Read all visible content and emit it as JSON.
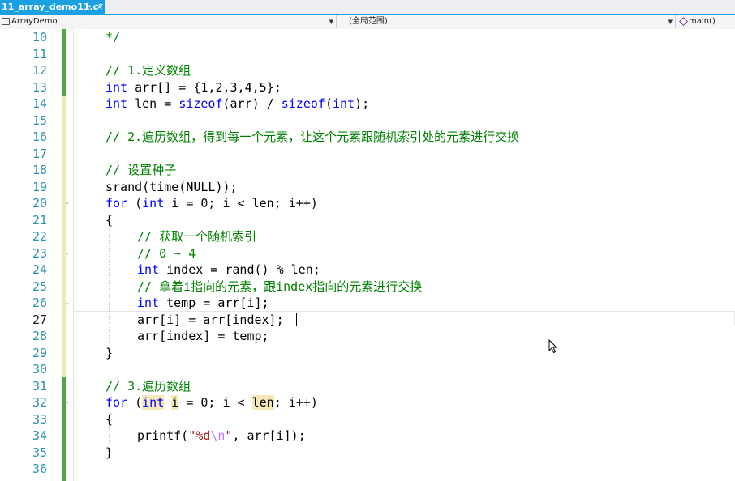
{
  "tab": {
    "title": "11_array_demo11.c*",
    "pin_icon": "pin-icon",
    "close_icon": "close-icon",
    "accent": "#1ba1e2"
  },
  "navbar": {
    "project": "ArrayDemo",
    "scope": "(全局范围)",
    "member": "main()"
  },
  "colors": {
    "keyword": "#0000ff",
    "comment": "#008000",
    "string": "#a31515",
    "line_number": "#2b91af"
  },
  "editor": {
    "current_line": 27,
    "lines": [
      {
        "n": "10",
        "segs": [
          {
            "t": "*/",
            "c": "cm"
          }
        ]
      },
      {
        "n": "11",
        "segs": []
      },
      {
        "n": "12",
        "segs": [
          {
            "t": "// 1.定义数组",
            "c": "cm"
          }
        ]
      },
      {
        "n": "13",
        "segs": [
          {
            "t": "int",
            "c": "kw"
          },
          {
            "t": " arr[] = {1,2,3,4,5};",
            "c": ""
          }
        ]
      },
      {
        "n": "14",
        "segs": [
          {
            "t": "int",
            "c": "kw"
          },
          {
            "t": " len = ",
            "c": ""
          },
          {
            "t": "sizeof",
            "c": "kw"
          },
          {
            "t": "(arr) / ",
            "c": ""
          },
          {
            "t": "sizeof",
            "c": "kw"
          },
          {
            "t": "(",
            "c": ""
          },
          {
            "t": "int",
            "c": "kw"
          },
          {
            "t": ");",
            "c": ""
          }
        ]
      },
      {
        "n": "15",
        "segs": []
      },
      {
        "n": "16",
        "segs": [
          {
            "t": "// 2.遍历数组，得到每一个元素，让这个元素跟随机索引处的元素进行交换",
            "c": "cm"
          }
        ]
      },
      {
        "n": "17",
        "segs": []
      },
      {
        "n": "18",
        "segs": [
          {
            "t": "// 设置种子",
            "c": "cm"
          }
        ]
      },
      {
        "n": "19",
        "segs": [
          {
            "t": "srand(time(NULL));",
            "c": ""
          }
        ]
      },
      {
        "n": "20",
        "segs": [
          {
            "t": "for",
            "c": "kw"
          },
          {
            "t": " (",
            "c": ""
          },
          {
            "t": "int",
            "c": "kw"
          },
          {
            "t": " i = 0; i < len; i++)",
            "c": ""
          }
        ]
      },
      {
        "n": "21",
        "segs": [
          {
            "t": "{",
            "c": ""
          }
        ]
      },
      {
        "n": "22",
        "indent": true,
        "segs": [
          {
            "t": "// 获取一个随机索引",
            "c": "cm"
          }
        ]
      },
      {
        "n": "23",
        "indent": true,
        "segs": [
          {
            "t": "// 0 ~ 4",
            "c": "cm"
          }
        ]
      },
      {
        "n": "24",
        "indent": true,
        "segs": [
          {
            "t": "int",
            "c": "kw"
          },
          {
            "t": " index = rand() % len;",
            "c": ""
          }
        ]
      },
      {
        "n": "25",
        "indent": true,
        "segs": [
          {
            "t": "// 拿着i指向的元素，跟index指向的元素进行交换",
            "c": "cm"
          }
        ]
      },
      {
        "n": "26",
        "indent": true,
        "segs": [
          {
            "t": "int",
            "c": "kw"
          },
          {
            "t": " temp = arr[i];",
            "c": ""
          }
        ]
      },
      {
        "n": "27",
        "indent": true,
        "segs": [
          {
            "t": "arr[i] = arr[index];",
            "c": ""
          }
        ]
      },
      {
        "n": "28",
        "indent": true,
        "segs": [
          {
            "t": "arr[index] = temp;",
            "c": ""
          }
        ]
      },
      {
        "n": "29",
        "segs": [
          {
            "t": "}",
            "c": ""
          }
        ]
      },
      {
        "n": "30",
        "segs": []
      },
      {
        "n": "31",
        "segs": [
          {
            "t": "// 3.遍历数组",
            "c": "cm"
          }
        ]
      },
      {
        "n": "32",
        "segs": [
          {
            "t": "for",
            "c": "kw"
          },
          {
            "t": " (",
            "c": ""
          },
          {
            "t": "int",
            "c": "kw hl"
          },
          {
            "t": " ",
            "c": ""
          },
          {
            "t": "i",
            "c": "hl"
          },
          {
            "t": " = 0; i < ",
            "c": ""
          },
          {
            "t": "len",
            "c": "hl"
          },
          {
            "t": "; i++)",
            "c": ""
          }
        ]
      },
      {
        "n": "33",
        "segs": [
          {
            "t": "{",
            "c": ""
          }
        ]
      },
      {
        "n": "34",
        "indent": true,
        "segs": [
          {
            "t": "printf(",
            "c": ""
          },
          {
            "t": "\"%d",
            "c": "st"
          },
          {
            "t": "\\n",
            "c": "esc"
          },
          {
            "t": "\"",
            "c": "st"
          },
          {
            "t": ", arr[i]);",
            "c": ""
          }
        ]
      },
      {
        "n": "35",
        "segs": [
          {
            "t": "}",
            "c": ""
          }
        ]
      },
      {
        "n": "36",
        "segs": []
      }
    ]
  }
}
